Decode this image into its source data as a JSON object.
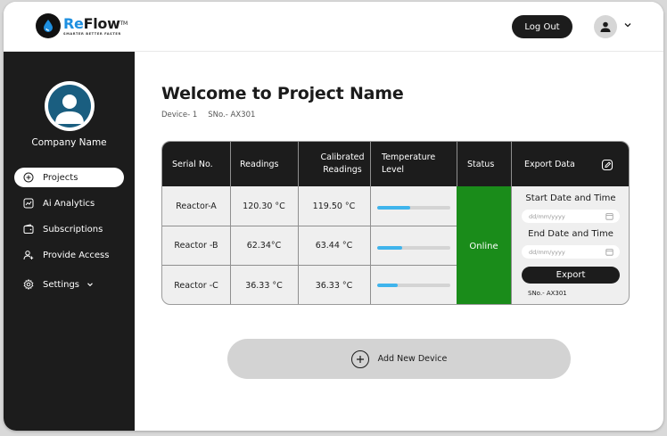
{
  "brand": {
    "name_part1": "Re",
    "name_part2": "Flow",
    "trademark": "TM",
    "tagline": "SMARTER BETTER FASTER"
  },
  "header": {
    "logout_label": "Log Out"
  },
  "sidebar": {
    "company_name": "Company Name",
    "items": [
      {
        "label": "Projects",
        "icon": "plus-circle-icon",
        "active": true
      },
      {
        "label": "Ai Analytics",
        "icon": "chart-icon",
        "active": false
      },
      {
        "label": "Subscriptions",
        "icon": "wallet-icon",
        "active": false
      },
      {
        "label": "Provide Access",
        "icon": "user-plus-icon",
        "active": false
      },
      {
        "label": "Settings",
        "icon": "gear-icon",
        "active": false
      }
    ]
  },
  "main": {
    "title": "Welcome to Project Name",
    "device": "Device- 1",
    "serial": "SNo.- AX301"
  },
  "table": {
    "headers": {
      "serial": "Serial No.",
      "readings": "Readings",
      "calibrated_line1": "Calibrated",
      "calibrated_line2": "Readings",
      "temp_line1": "Temperature",
      "temp_line2": "Level",
      "status": "Status",
      "export": "Export Data"
    },
    "rows": [
      {
        "serial": "Reactor-A",
        "reading": "120.30 °C",
        "calibrated": "119.50 °C",
        "level": 0.45
      },
      {
        "serial": "Reactor -B",
        "reading": "62.34°C",
        "calibrated": "63.44 °C",
        "level": 0.34
      },
      {
        "serial": "Reactor -C",
        "reading": "36.33 °C",
        "calibrated": "36.33 °C",
        "level": 0.28
      }
    ],
    "status": "Online",
    "export": {
      "start_label": "Start Date and Time",
      "start_placeholder": "dd/mm/yyyy",
      "end_label": "End Date and Time",
      "end_placeholder": "dd/mm/yyyy",
      "button": "Export",
      "sno": "SNo.- AX301"
    }
  },
  "add_device": {
    "label": "Add New Device"
  },
  "colors": {
    "dark": "#1c1c1c",
    "online": "#1a8c1a",
    "level_bar": "#3fb4ec",
    "brand_blue": "#1e8fe0"
  }
}
